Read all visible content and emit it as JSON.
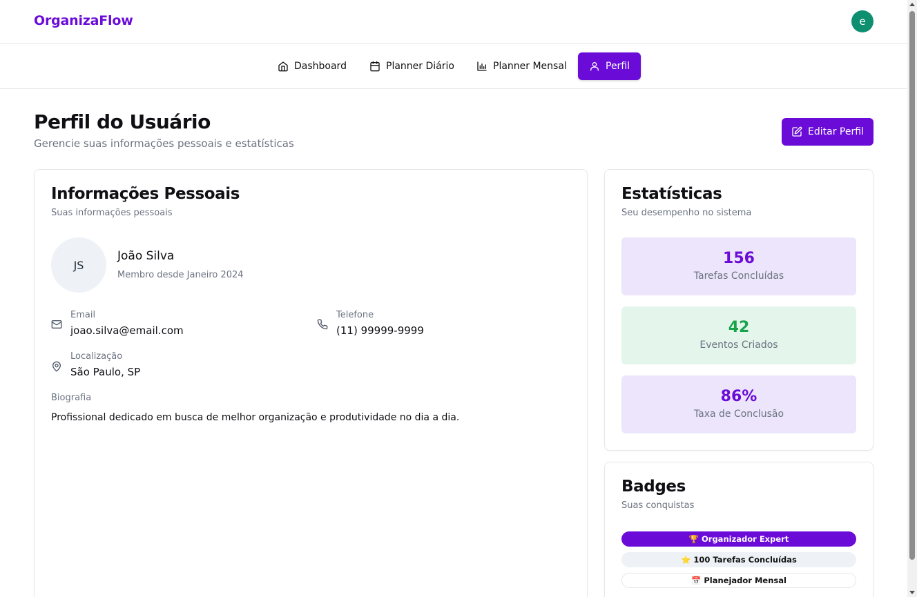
{
  "brand": "OrganizaFlow",
  "user_avatar_letter": "e",
  "nav": {
    "items": [
      {
        "label": "Dashboard",
        "icon": "home-icon",
        "active": false
      },
      {
        "label": "Planner Diário",
        "icon": "calendar-icon",
        "active": false
      },
      {
        "label": "Planner Mensal",
        "icon": "bar-chart-icon",
        "active": false
      },
      {
        "label": "Perfil",
        "icon": "user-icon",
        "active": true
      }
    ]
  },
  "header": {
    "title": "Perfil do Usuário",
    "subtitle": "Gerencie suas informações pessoais e estatísticas",
    "edit_label": "Editar Perfil"
  },
  "personal": {
    "title": "Informações Pessoais",
    "subtitle": "Suas informações pessoais",
    "initials": "JS",
    "name": "João Silva",
    "member_since": "Membro desde Janeiro 2024",
    "email_label": "Email",
    "email": "joao.silva@email.com",
    "phone_label": "Telefone",
    "phone": "(11) 99999-9999",
    "location_label": "Localização",
    "location": "São Paulo, SP",
    "bio_label": "Biografia",
    "bio": "Profissional dedicado em busca de melhor organização e produtividade no dia a dia."
  },
  "stats": {
    "title": "Estatísticas",
    "subtitle": "Seu desempenho no sistema",
    "items": [
      {
        "value": "156",
        "label": "Tarefas Concluídas",
        "color": "#6a0bd8"
      },
      {
        "value": "42",
        "label": "Eventos Criados",
        "color": "#16a34a"
      },
      {
        "value": "86%",
        "label": "Taxa de Conclusão",
        "color": "#6a0bd8"
      }
    ]
  },
  "badges": {
    "title": "Badges",
    "subtitle": "Suas conquistas",
    "items": [
      {
        "emoji": "🏆",
        "label": "Organizador Expert"
      },
      {
        "emoji": "⭐",
        "label": "100 Tarefas Concluídas"
      },
      {
        "emoji": "📅",
        "label": "Planejador Mensal"
      }
    ]
  },
  "colors": {
    "primary": "#6a0bd8",
    "success": "#16a34a",
    "avatar": "#0e9070"
  }
}
